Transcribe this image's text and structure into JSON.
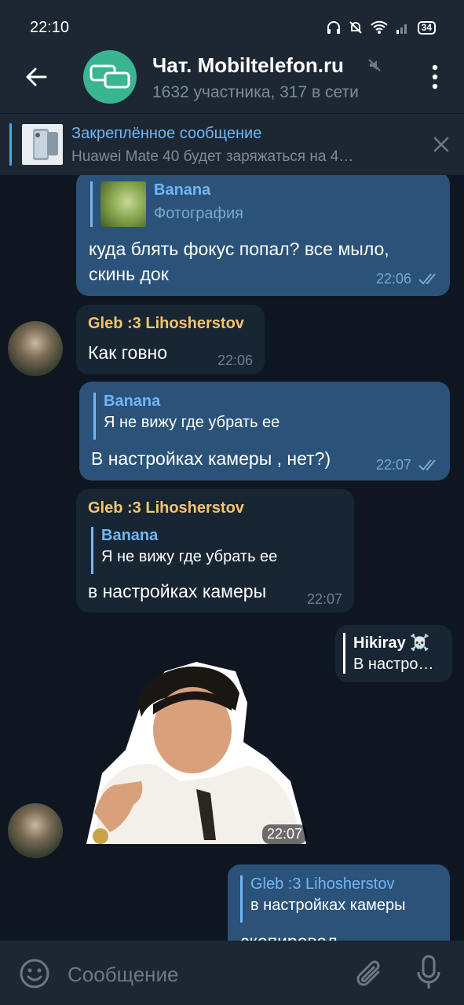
{
  "status_bar": {
    "time": "22:10",
    "battery": "34"
  },
  "header": {
    "title": "Чат. Mobiltelefon.ru",
    "subtitle": "1632 участника, 317 в сети"
  },
  "pinned": {
    "title": "Закреплённое сообщение",
    "text": "Huawei Mate 40 будет заряжаться на 4…"
  },
  "messages": [
    {
      "reply_name": "Banana",
      "reply_text": "Фотография",
      "text_line1": "куда блять фокус попал? все мыло,",
      "text_line2": "скинь док",
      "time": "22:06"
    },
    {
      "sender": "Gleb :3 Lihosherstov",
      "text": "Как говно",
      "time": "22:06"
    },
    {
      "reply_name": "Banana",
      "reply_text": "Я не вижу где убрать ее",
      "text": "В настройках камеры , нет?)",
      "time": "22:07"
    },
    {
      "sender": "Gleb :3 Lihosherstov",
      "reply_name": "Banana",
      "reply_text": "Я не вижу где убрать ее",
      "text": "в настройках камеры",
      "time": "22:07"
    },
    {
      "reply_name": "Hikiray ☠️",
      "reply_text": "В настро…"
    },
    {
      "sticker_time": "22:07"
    },
    {
      "reply_name": "Gleb :3 Lihosherstov",
      "reply_text": "в настройках камеры",
      "text": "скопировал"
    }
  ],
  "input": {
    "placeholder": "Сообщение"
  },
  "colors": {
    "accent": "#71b7f5",
    "sender": "#f5c46c",
    "outgoing": "#2b5278",
    "incoming": "#182533",
    "background": "#0e1621"
  }
}
